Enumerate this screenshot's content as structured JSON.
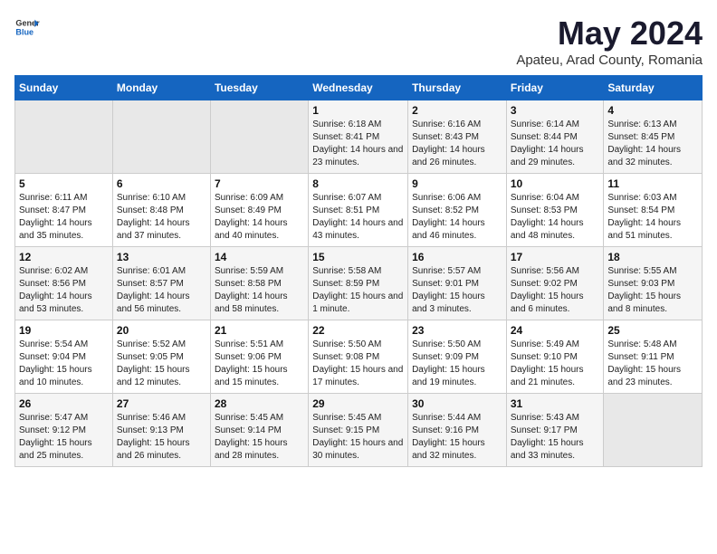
{
  "logo": {
    "general": "General",
    "blue": "Blue"
  },
  "header": {
    "title": "May 2024",
    "subtitle": "Apateu, Arad County, Romania"
  },
  "weekdays": [
    "Sunday",
    "Monday",
    "Tuesday",
    "Wednesday",
    "Thursday",
    "Friday",
    "Saturday"
  ],
  "weeks": [
    [
      {
        "day": "",
        "empty": true
      },
      {
        "day": "",
        "empty": true
      },
      {
        "day": "",
        "empty": true
      },
      {
        "day": "1",
        "sunrise": "6:18 AM",
        "sunset": "8:41 PM",
        "daylight": "14 hours and 23 minutes."
      },
      {
        "day": "2",
        "sunrise": "6:16 AM",
        "sunset": "8:43 PM",
        "daylight": "14 hours and 26 minutes."
      },
      {
        "day": "3",
        "sunrise": "6:14 AM",
        "sunset": "8:44 PM",
        "daylight": "14 hours and 29 minutes."
      },
      {
        "day": "4",
        "sunrise": "6:13 AM",
        "sunset": "8:45 PM",
        "daylight": "14 hours and 32 minutes."
      }
    ],
    [
      {
        "day": "5",
        "sunrise": "6:11 AM",
        "sunset": "8:47 PM",
        "daylight": "14 hours and 35 minutes."
      },
      {
        "day": "6",
        "sunrise": "6:10 AM",
        "sunset": "8:48 PM",
        "daylight": "14 hours and 37 minutes."
      },
      {
        "day": "7",
        "sunrise": "6:09 AM",
        "sunset": "8:49 PM",
        "daylight": "14 hours and 40 minutes."
      },
      {
        "day": "8",
        "sunrise": "6:07 AM",
        "sunset": "8:51 PM",
        "daylight": "14 hours and 43 minutes."
      },
      {
        "day": "9",
        "sunrise": "6:06 AM",
        "sunset": "8:52 PM",
        "daylight": "14 hours and 46 minutes."
      },
      {
        "day": "10",
        "sunrise": "6:04 AM",
        "sunset": "8:53 PM",
        "daylight": "14 hours and 48 minutes."
      },
      {
        "day": "11",
        "sunrise": "6:03 AM",
        "sunset": "8:54 PM",
        "daylight": "14 hours and 51 minutes."
      }
    ],
    [
      {
        "day": "12",
        "sunrise": "6:02 AM",
        "sunset": "8:56 PM",
        "daylight": "14 hours and 53 minutes."
      },
      {
        "day": "13",
        "sunrise": "6:01 AM",
        "sunset": "8:57 PM",
        "daylight": "14 hours and 56 minutes."
      },
      {
        "day": "14",
        "sunrise": "5:59 AM",
        "sunset": "8:58 PM",
        "daylight": "14 hours and 58 minutes."
      },
      {
        "day": "15",
        "sunrise": "5:58 AM",
        "sunset": "8:59 PM",
        "daylight": "15 hours and 1 minute."
      },
      {
        "day": "16",
        "sunrise": "5:57 AM",
        "sunset": "9:01 PM",
        "daylight": "15 hours and 3 minutes."
      },
      {
        "day": "17",
        "sunrise": "5:56 AM",
        "sunset": "9:02 PM",
        "daylight": "15 hours and 6 minutes."
      },
      {
        "day": "18",
        "sunrise": "5:55 AM",
        "sunset": "9:03 PM",
        "daylight": "15 hours and 8 minutes."
      }
    ],
    [
      {
        "day": "19",
        "sunrise": "5:54 AM",
        "sunset": "9:04 PM",
        "daylight": "15 hours and 10 minutes."
      },
      {
        "day": "20",
        "sunrise": "5:52 AM",
        "sunset": "9:05 PM",
        "daylight": "15 hours and 12 minutes."
      },
      {
        "day": "21",
        "sunrise": "5:51 AM",
        "sunset": "9:06 PM",
        "daylight": "15 hours and 15 minutes."
      },
      {
        "day": "22",
        "sunrise": "5:50 AM",
        "sunset": "9:08 PM",
        "daylight": "15 hours and 17 minutes."
      },
      {
        "day": "23",
        "sunrise": "5:50 AM",
        "sunset": "9:09 PM",
        "daylight": "15 hours and 19 minutes."
      },
      {
        "day": "24",
        "sunrise": "5:49 AM",
        "sunset": "9:10 PM",
        "daylight": "15 hours and 21 minutes."
      },
      {
        "day": "25",
        "sunrise": "5:48 AM",
        "sunset": "9:11 PM",
        "daylight": "15 hours and 23 minutes."
      }
    ],
    [
      {
        "day": "26",
        "sunrise": "5:47 AM",
        "sunset": "9:12 PM",
        "daylight": "15 hours and 25 minutes."
      },
      {
        "day": "27",
        "sunrise": "5:46 AM",
        "sunset": "9:13 PM",
        "daylight": "15 hours and 26 minutes."
      },
      {
        "day": "28",
        "sunrise": "5:45 AM",
        "sunset": "9:14 PM",
        "daylight": "15 hours and 28 minutes."
      },
      {
        "day": "29",
        "sunrise": "5:45 AM",
        "sunset": "9:15 PM",
        "daylight": "15 hours and 30 minutes."
      },
      {
        "day": "30",
        "sunrise": "5:44 AM",
        "sunset": "9:16 PM",
        "daylight": "15 hours and 32 minutes."
      },
      {
        "day": "31",
        "sunrise": "5:43 AM",
        "sunset": "9:17 PM",
        "daylight": "15 hours and 33 minutes."
      },
      {
        "day": "",
        "empty": true
      }
    ]
  ]
}
